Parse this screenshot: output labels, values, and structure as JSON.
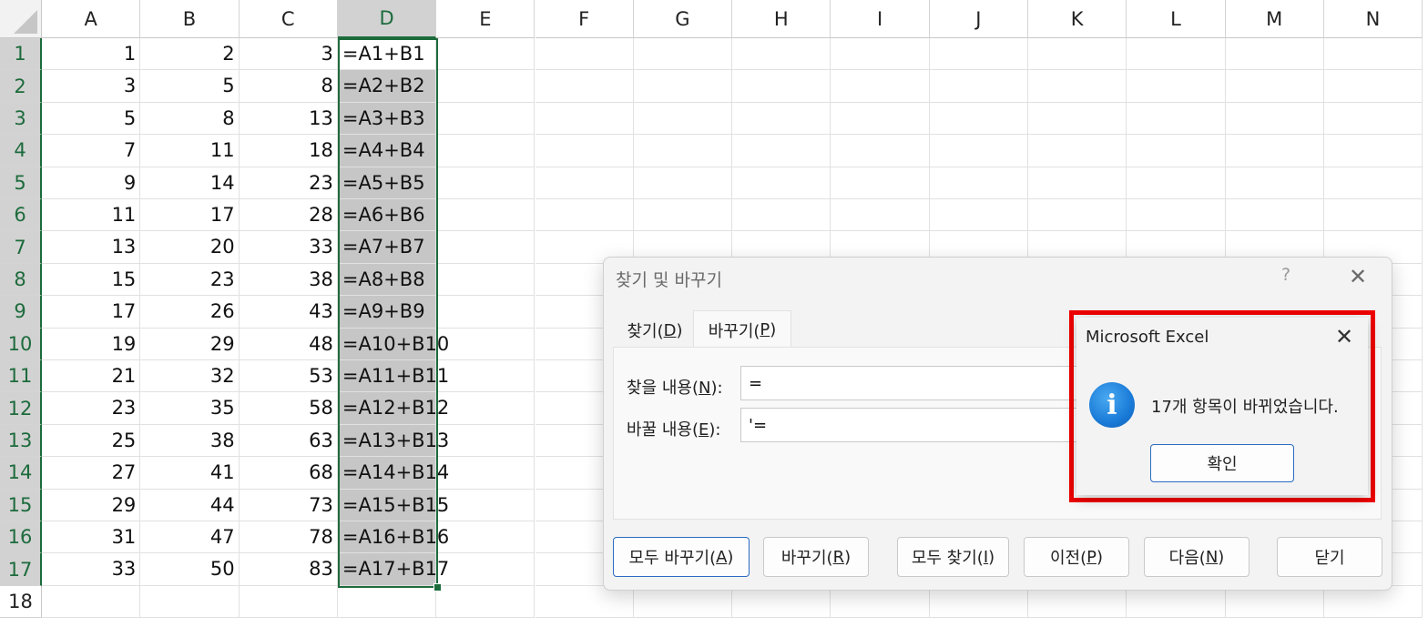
{
  "sheet": {
    "columns": [
      "A",
      "B",
      "C",
      "D",
      "E",
      "F",
      "G",
      "H",
      "I",
      "J",
      "K",
      "L",
      "M",
      "N"
    ],
    "selected_column": "D",
    "rows": [
      {
        "n": "1",
        "a": "1",
        "b": "2",
        "c": "3",
        "d": "=A1+B1"
      },
      {
        "n": "2",
        "a": "3",
        "b": "5",
        "c": "8",
        "d": "=A2+B2"
      },
      {
        "n": "3",
        "a": "5",
        "b": "8",
        "c": "13",
        "d": "=A3+B3"
      },
      {
        "n": "4",
        "a": "7",
        "b": "11",
        "c": "18",
        "d": "=A4+B4"
      },
      {
        "n": "5",
        "a": "9",
        "b": "14",
        "c": "23",
        "d": "=A5+B5"
      },
      {
        "n": "6",
        "a": "11",
        "b": "17",
        "c": "28",
        "d": "=A6+B6"
      },
      {
        "n": "7",
        "a": "13",
        "b": "20",
        "c": "33",
        "d": "=A7+B7"
      },
      {
        "n": "8",
        "a": "15",
        "b": "23",
        "c": "38",
        "d": "=A8+B8"
      },
      {
        "n": "9",
        "a": "17",
        "b": "26",
        "c": "43",
        "d": "=A9+B9"
      },
      {
        "n": "10",
        "a": "19",
        "b": "29",
        "c": "48",
        "d": "=A10+B10"
      },
      {
        "n": "11",
        "a": "21",
        "b": "32",
        "c": "53",
        "d": "=A11+B11"
      },
      {
        "n": "12",
        "a": "23",
        "b": "35",
        "c": "58",
        "d": "=A12+B12"
      },
      {
        "n": "13",
        "a": "25",
        "b": "38",
        "c": "63",
        "d": "=A13+B13"
      },
      {
        "n": "14",
        "a": "27",
        "b": "41",
        "c": "68",
        "d": "=A14+B14"
      },
      {
        "n": "15",
        "a": "29",
        "b": "44",
        "c": "73",
        "d": "=A15+B15"
      },
      {
        "n": "16",
        "a": "31",
        "b": "47",
        "c": "78",
        "d": "=A16+B16"
      },
      {
        "n": "17",
        "a": "33",
        "b": "50",
        "c": "83",
        "d": "=A17+B17"
      },
      {
        "n": "18",
        "a": "",
        "b": "",
        "c": "",
        "d": ""
      }
    ]
  },
  "find_dialog": {
    "title": "찾기 및 바꾸기",
    "help": "?",
    "close": "✕",
    "tabs": {
      "find": {
        "text": "찾기(",
        "key": "D",
        "end": ")"
      },
      "replace": {
        "text": "바꾸기(",
        "key": "P",
        "end": ")"
      }
    },
    "find_label": {
      "text": "찾을 내용(",
      "key": "N",
      "end": "):"
    },
    "replace_label": {
      "text": "바꿀 내용(",
      "key": "E",
      "end": "):"
    },
    "find_value": "=",
    "replace_value": "'=",
    "buttons": {
      "replace_all": {
        "text": "모두 바꾸기(",
        "key": "A",
        "end": ")"
      },
      "replace": {
        "text": "바꾸기(",
        "key": "R",
        "end": ")"
      },
      "find_all": {
        "text": "모두 찾기(",
        "key": "I",
        "end": ")"
      },
      "previous": {
        "text": "이전(",
        "key": "P",
        "end": ")"
      },
      "next": {
        "text": "다음(",
        "key": "N",
        "end": ")"
      },
      "close": "닫기"
    }
  },
  "message_box": {
    "title": "Microsoft Excel",
    "close": "✕",
    "icon": "info-icon",
    "icon_glyph": "i",
    "message": "17개 항목이 바뀌었습니다.",
    "ok": "확인"
  },
  "colors": {
    "selection": "#1d6b3c",
    "highlight": "#ee0000",
    "info_icon": "#1a7bd8"
  }
}
